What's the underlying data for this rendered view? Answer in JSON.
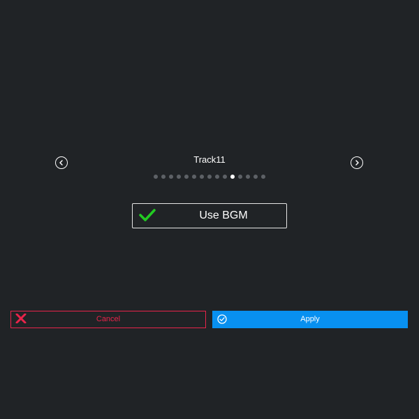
{
  "track": {
    "title": "Track11",
    "count": 15,
    "active_index": 10
  },
  "bgm_toggle": {
    "label": "Use BGM",
    "checked": true,
    "check_color": "#22cc22"
  },
  "actions": {
    "cancel_label": "Cancel",
    "apply_label": "Apply"
  },
  "icons": {
    "prev": "chevron-left-circle-icon",
    "next": "chevron-right-circle-icon",
    "cancel": "close-icon",
    "apply": "check-circle-icon",
    "bgm": "checkmark-icon"
  },
  "colors": {
    "background": "#202326",
    "cancel": "#e8244a",
    "apply": "#0890f0",
    "dot_inactive": "#5d6166",
    "dot_active": "#ffffff"
  }
}
